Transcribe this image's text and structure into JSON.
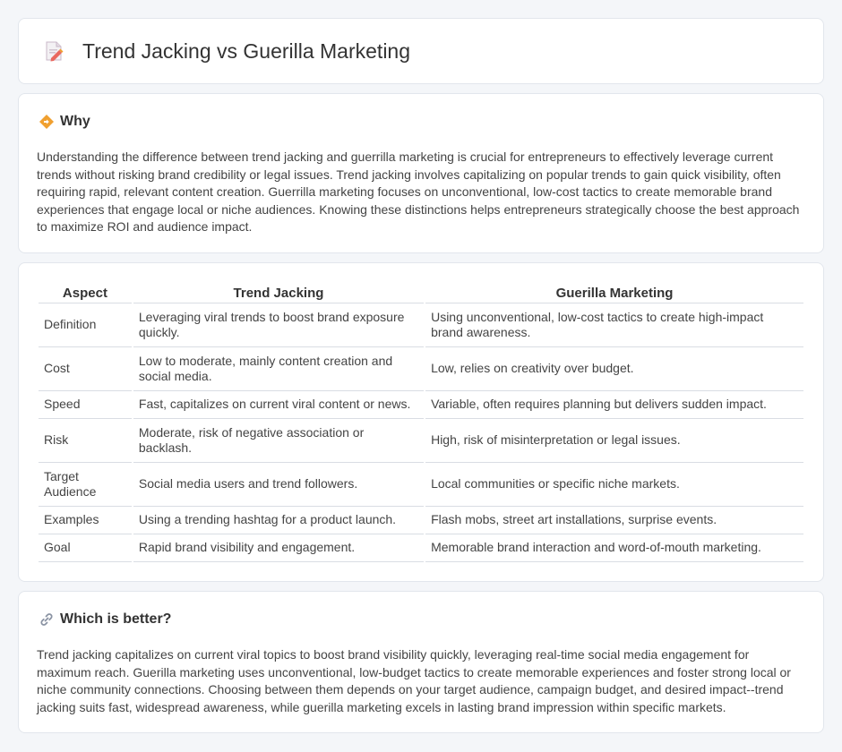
{
  "header": {
    "title": "Trend Jacking vs Guerilla Marketing",
    "icon": "document-pencil-icon"
  },
  "why": {
    "title": "Why",
    "icon": "diamond-signpost-icon",
    "text": "Understanding the difference between trend jacking and guerrilla marketing is crucial for entrepreneurs to effectively leverage current trends without risking brand credibility or legal issues. Trend jacking involves capitalizing on popular trends to gain quick visibility, often requiring rapid, relevant content creation. Guerrilla marketing focuses on unconventional, low-cost tactics to create memorable brand experiences that engage local or niche audiences. Knowing these distinctions helps entrepreneurs strategically choose the best approach to maximize ROI and audience impact."
  },
  "comparison": {
    "headers": [
      "Aspect",
      "Trend Jacking",
      "Guerilla Marketing"
    ],
    "rows": [
      [
        "Definition",
        "Leveraging viral trends to boost brand exposure quickly.",
        "Using unconventional, low-cost tactics to create high-impact brand awareness."
      ],
      [
        "Cost",
        "Low to moderate, mainly content creation and social media.",
        "Low, relies on creativity over budget."
      ],
      [
        "Speed",
        "Fast, capitalizes on current viral content or news.",
        "Variable, often requires planning but delivers sudden impact."
      ],
      [
        "Risk",
        "Moderate, risk of negative association or backlash.",
        "High, risk of misinterpretation or legal issues."
      ],
      [
        "Target Audience",
        "Social media users and trend followers.",
        "Local communities or specific niche markets."
      ],
      [
        "Examples",
        "Using a trending hashtag for a product launch.",
        "Flash mobs, street art installations, surprise events."
      ],
      [
        "Goal",
        "Rapid brand visibility and engagement.",
        "Memorable brand interaction and word-of-mouth marketing."
      ]
    ]
  },
  "better": {
    "title": "Which is better?",
    "icon": "link-icon",
    "text": "Trend jacking capitalizes on current viral topics to boost brand visibility quickly, leveraging real-time social media engagement for maximum reach. Guerilla marketing uses unconventional, low-budget tactics to create memorable experiences and foster strong local or niche community connections. Choosing between them depends on your target audience, campaign budget, and desired impact--trend jacking suits fast, widespread awareness, while guerilla marketing excels in lasting brand impression within specific markets."
  },
  "colors": {
    "background": "#f4f6f9",
    "card": "#ffffff",
    "border": "#e2e6ec",
    "accent": "#f0a030"
  }
}
